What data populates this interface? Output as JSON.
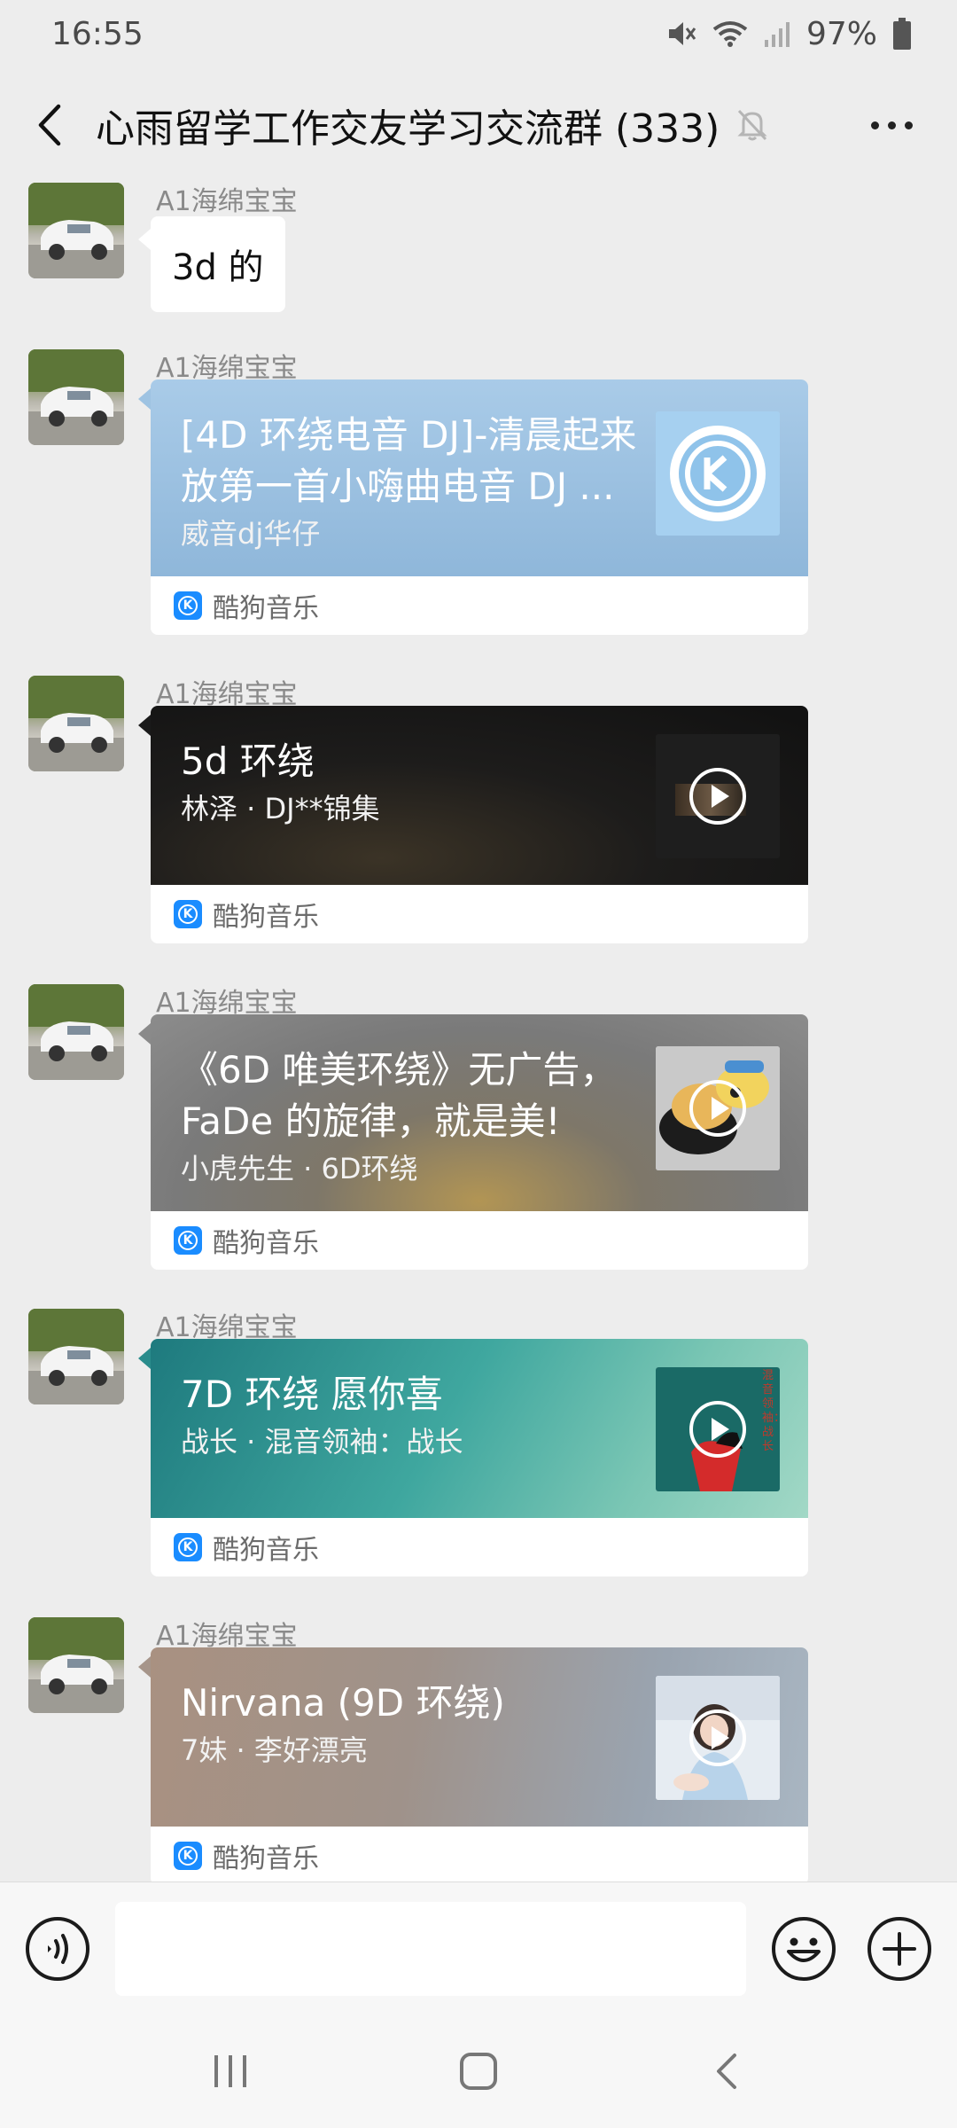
{
  "status": {
    "time": "16:55",
    "battery": "97%"
  },
  "header": {
    "title": "心雨留学工作交友学习交流群 (333)"
  },
  "messages": [
    {
      "sender": "A1海绵宝宝",
      "type": "text",
      "text": "3d 的"
    },
    {
      "sender": "A1海绵宝宝",
      "type": "music",
      "title": "[4D 环绕电音 DJ]-清晨起来放第一首小嗨曲电音 DJ ...",
      "subtitle": "威音dj华仔",
      "source": "酷狗音乐"
    },
    {
      "sender": "A1海绵宝宝",
      "type": "music",
      "title": "5d 环绕",
      "subtitle": "林泽 · DJ**锦集",
      "source": "酷狗音乐"
    },
    {
      "sender": "A1海绵宝宝",
      "type": "music",
      "title": "《6D 唯美环绕》无广告， FaDe 的旋律，就是美!",
      "subtitle": "小虎先生 · 6D环绕",
      "source": "酷狗音乐"
    },
    {
      "sender": "A1海绵宝宝",
      "type": "music",
      "title": "7D 环绕 愿你喜",
      "subtitle": "战长 · 混音领袖：战长",
      "source": "酷狗音乐",
      "cover_text": "混音领袖：战长"
    },
    {
      "sender": "A1海绵宝宝",
      "type": "music",
      "title": "Nirvana (9D 环绕)",
      "subtitle": "7妹 · 李好漂亮",
      "source": "酷狗音乐"
    }
  ],
  "input": {
    "value": ""
  },
  "icons": {
    "back": "back-arrow-icon",
    "mute": "bell-off-icon",
    "more": "more-dots-icon",
    "voice": "voice-icon",
    "emoji": "emoji-icon",
    "plus": "plus-icon",
    "play": "play-icon",
    "kugou": "kugou-logo-icon"
  },
  "colors": {
    "background": "#ededed",
    "kugou_blue": "#1a8cff"
  }
}
